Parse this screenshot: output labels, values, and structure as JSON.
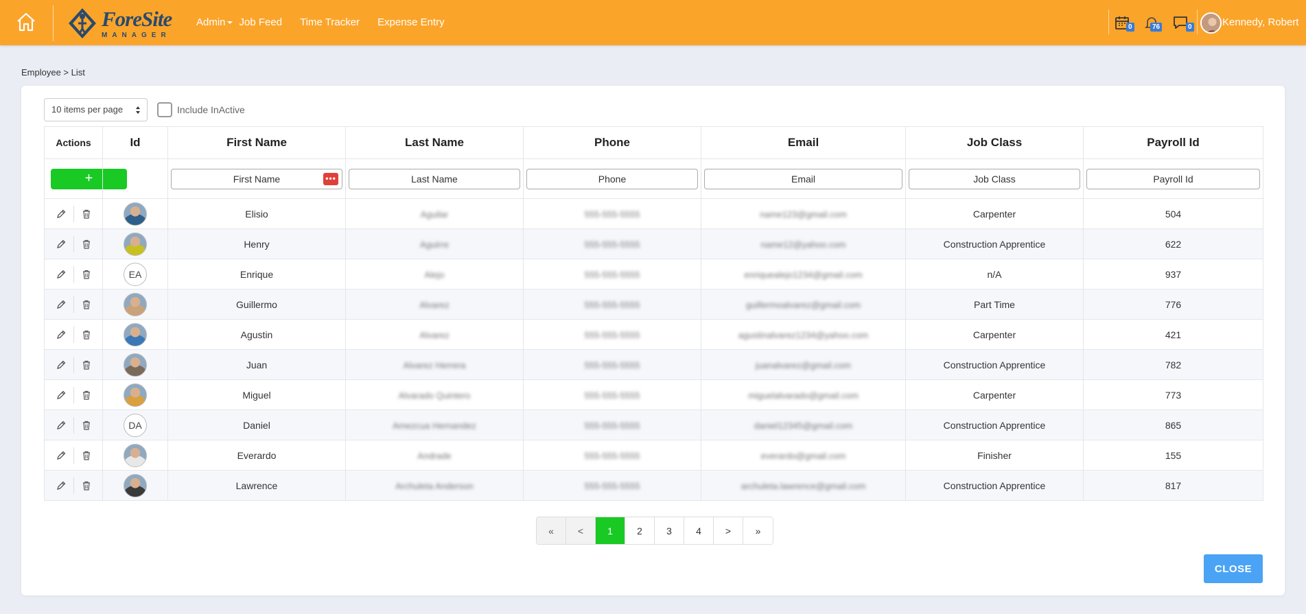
{
  "nav": {
    "brand_name": "ForeSite",
    "brand_sub": "MANAGER",
    "items": [
      {
        "label": "Admin"
      },
      {
        "label": "Job Feed"
      },
      {
        "label": "Time Tracker"
      },
      {
        "label": "Expense Entry"
      }
    ],
    "calendar_badge": "0",
    "bell_badge": "76",
    "chat_badge": "0",
    "user_name": "Kennedy, Robert"
  },
  "breadcrumb": "Employee > List",
  "controls": {
    "per_page": "10 items per page",
    "include_inactive": "Include InActive"
  },
  "table": {
    "headers": [
      "Actions",
      "Id",
      "First Name",
      "Last Name",
      "Phone",
      "Email",
      "Job Class",
      "Payroll Id"
    ],
    "add_label": "+",
    "dots_label": "•••",
    "filters": {
      "first_name": "First Name",
      "last_name": "Last Name",
      "phone": "Phone",
      "email": "Email",
      "job_class": "Job Class",
      "payroll_id": "Payroll Id"
    },
    "rows": [
      {
        "avatar": "photo",
        "first": "Elisio",
        "last": "Aguilar",
        "phone": "555-555-5555",
        "email": "name123@gmail.com",
        "job": "Carpenter",
        "payroll": "504"
      },
      {
        "avatar": "photo",
        "first": "Henry",
        "last": "Aguirre",
        "phone": "555-555-5555",
        "email": "name12@yahoo.com",
        "job": "Construction Apprentice",
        "payroll": "622"
      },
      {
        "avatar": "EA",
        "first": "Enrique",
        "last": "Alejo",
        "phone": "555-555-5555",
        "email": "enriquealejo1234@gmail.com",
        "job": "n/A",
        "payroll": "937"
      },
      {
        "avatar": "photo",
        "first": "Guillermo",
        "last": "Alvarez",
        "phone": "555-555-5555",
        "email": "guillermoalvarez@gmail.com",
        "job": "Part Time",
        "payroll": "776"
      },
      {
        "avatar": "photo",
        "first": "Agustin",
        "last": "Alvarez",
        "phone": "555-555-5555",
        "email": "agustinalvarez1234@yahoo.com",
        "job": "Carpenter",
        "payroll": "421"
      },
      {
        "avatar": "photo",
        "first": "Juan",
        "last": "Alvarez Herrera",
        "phone": "555-555-5555",
        "email": "juanalvarez@gmail.com",
        "job": "Construction Apprentice",
        "payroll": "782"
      },
      {
        "avatar": "photo",
        "first": "Miguel",
        "last": "Alvarado Quintero",
        "phone": "555-555-5555",
        "email": "miguelalvarado@gmail.com",
        "job": "Carpenter",
        "payroll": "773"
      },
      {
        "avatar": "DA",
        "first": "Daniel",
        "last": "Amezcua Hernandez",
        "phone": "555-555-5555",
        "email": "daniel12345@gmail.com",
        "job": "Construction Apprentice",
        "payroll": "865"
      },
      {
        "avatar": "photo",
        "first": "Everardo",
        "last": "Andrade",
        "phone": "555-555-5555",
        "email": "everardo@gmail.com",
        "job": "Finisher",
        "payroll": "155"
      },
      {
        "avatar": "photo",
        "first": "Lawrence",
        "last": "Archuleta Anderson",
        "phone": "555-555-5555",
        "email": "archuleta.lawrence@gmail.com",
        "job": "Construction Apprentice",
        "payroll": "817"
      }
    ]
  },
  "pagination": {
    "pages": [
      "«",
      "<",
      "1",
      "2",
      "3",
      "4",
      ">",
      "»"
    ],
    "active": "1"
  },
  "close_label": "CLOSE",
  "colors": {
    "topbar": "#fba42a",
    "accent_green": "#19c924",
    "close_blue": "#4aa3f5",
    "badge_blue": "#3a7bd5"
  }
}
